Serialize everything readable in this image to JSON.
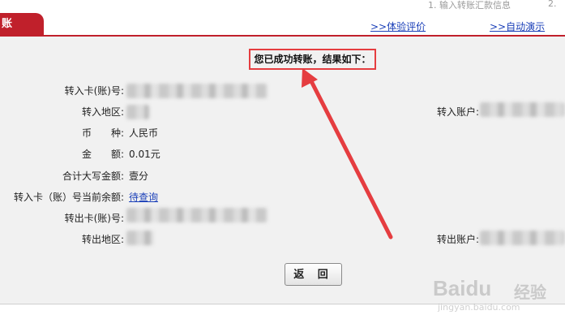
{
  "header": {
    "tab_label": "账",
    "hint_text": "1. 输入转账汇款信息",
    "hint_text_2": "2.",
    "link_experience": ">>体验评价",
    "link_demo": ">>自动演示"
  },
  "notice": {
    "text": "您已成功转账，结果如下："
  },
  "form": {
    "to_card_label": "转入卡(账)号:",
    "to_region_label": "转入地区:",
    "currency_label": "币　　种:",
    "currency_value": "人民币",
    "amount_label": "金　　额:",
    "amount_value": "0.01元",
    "amount_words_label": "合计大写金额:",
    "amount_words_value": "壹分",
    "balance_label": "转入卡（账）号当前余额:",
    "balance_link": "待查询",
    "from_card_label": "转出卡(账)号:",
    "from_region_label": "转出地区:",
    "to_account_label": "转入账户:",
    "from_account_label": "转出账户:"
  },
  "buttons": {
    "back": "返 回"
  },
  "watermark": {
    "brand": "Baidu",
    "brand_cn": "经验",
    "url": "jingyan.baidu.com"
  },
  "colors": {
    "accent_red": "#c0202b",
    "annotation_red": "#e53d40",
    "link_blue": "#1a3fb8",
    "panel_bg": "#f1f1f1"
  }
}
